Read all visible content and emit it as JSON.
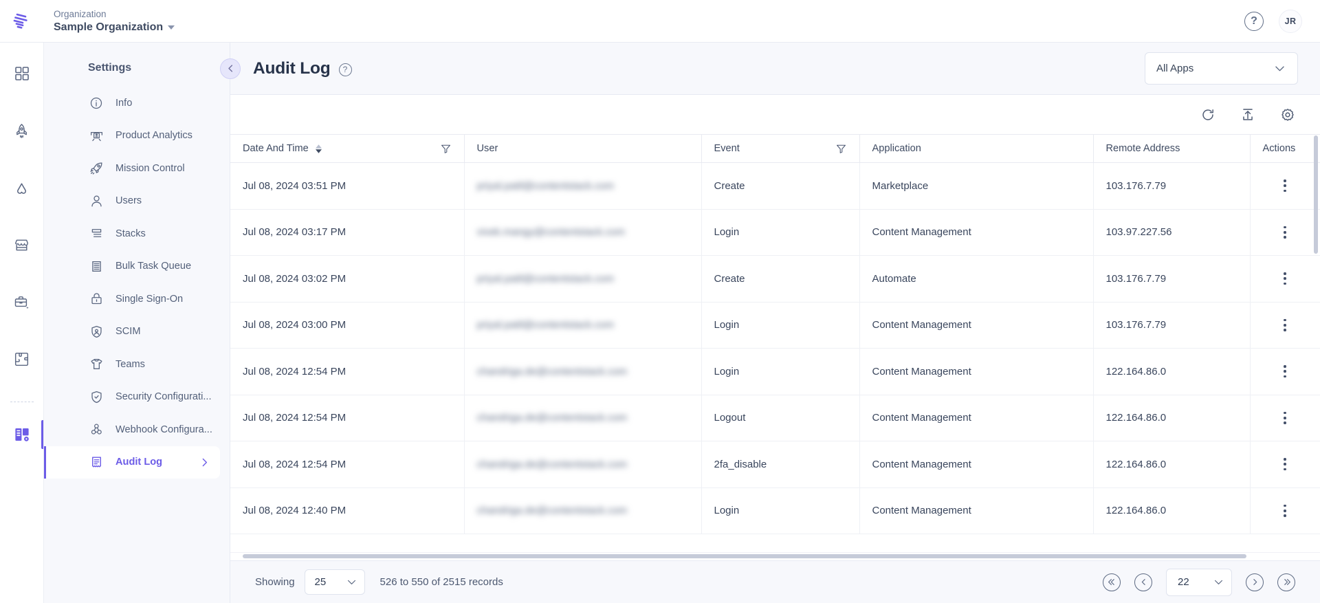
{
  "topbar": {
    "logo_icon": "contentstack-logo-icon",
    "org_label": "Organization",
    "org_name": "Sample Organization",
    "help_glyph": "?",
    "avatar_initials": "JR"
  },
  "rail": {
    "items": [
      {
        "icon": "dashboard-grid-icon",
        "name": "rail-item-dashboard",
        "active": false
      },
      {
        "icon": "rocket-icon",
        "name": "rail-item-launch",
        "active": false
      },
      {
        "icon": "automate-icon",
        "name": "rail-item-automate",
        "active": false
      },
      {
        "icon": "marketplace-icon",
        "name": "rail-item-marketplace",
        "active": false
      },
      {
        "icon": "briefcase-icon",
        "name": "rail-item-personalize",
        "active": false
      },
      {
        "icon": "puzzle-icon",
        "name": "rail-item-apps",
        "active": false
      },
      {
        "icon": "org-settings-icon",
        "name": "rail-item-org-settings",
        "active": true
      }
    ]
  },
  "sidebar": {
    "title": "Settings",
    "items": [
      {
        "label": "Info",
        "icon": "info-circle-icon",
        "active": false
      },
      {
        "label": "Product Analytics",
        "icon": "analytics-icon",
        "active": false
      },
      {
        "label": "Mission Control",
        "icon": "rocket-icon",
        "active": false
      },
      {
        "label": "Users",
        "icon": "user-icon",
        "active": false
      },
      {
        "label": "Stacks",
        "icon": "stacks-icon",
        "active": false
      },
      {
        "label": "Bulk Task Queue",
        "icon": "list-icon",
        "active": false
      },
      {
        "label": "Single Sign-On",
        "icon": "lock-icon",
        "active": false
      },
      {
        "label": "SCIM",
        "icon": "shield-user-icon",
        "active": false
      },
      {
        "label": "Teams",
        "icon": "tshirt-icon",
        "active": false
      },
      {
        "label": "Security Configurati...",
        "icon": "shield-check-icon",
        "active": false
      },
      {
        "label": "Webhook Configura...",
        "icon": "webhook-icon",
        "active": false
      },
      {
        "label": "Audit Log",
        "icon": "receipt-icon",
        "active": true
      }
    ]
  },
  "page": {
    "back_icon": "chevron-left-icon",
    "title": "Audit Log",
    "help_glyph": "?",
    "apps_filter_value": "All Apps",
    "apps_filter_icon": "chevron-down-icon"
  },
  "toolbar": {
    "refresh_icon": "refresh-icon",
    "export_icon": "export-upload-icon",
    "settings_icon": "gear-icon"
  },
  "table": {
    "columns": [
      {
        "label": "Date And Time",
        "sortable": true,
        "filterable": true
      },
      {
        "label": "User",
        "sortable": false,
        "filterable": false
      },
      {
        "label": "Event",
        "sortable": false,
        "filterable": true
      },
      {
        "label": "Application",
        "sortable": false,
        "filterable": false
      },
      {
        "label": "Remote Address",
        "sortable": false,
        "filterable": false
      },
      {
        "label": "Actions",
        "sortable": false,
        "filterable": false
      }
    ],
    "rows": [
      {
        "datetime": "Jul 08, 2024 03:51 PM",
        "user": "priyal.patil@contentstack.com",
        "event": "Create",
        "application": "Marketplace",
        "remote_address": "103.176.7.79"
      },
      {
        "datetime": "Jul 08, 2024 03:17 PM",
        "user": "vivek.mangy@contentstack.com",
        "event": "Login",
        "application": "Content Management",
        "remote_address": "103.97.227.56"
      },
      {
        "datetime": "Jul 08, 2024 03:02 PM",
        "user": "priyal.patil@contentstack.com",
        "event": "Create",
        "application": "Automate",
        "remote_address": "103.176.7.79"
      },
      {
        "datetime": "Jul 08, 2024 03:00 PM",
        "user": "priyal.patil@contentstack.com",
        "event": "Login",
        "application": "Content Management",
        "remote_address": "103.176.7.79"
      },
      {
        "datetime": "Jul 08, 2024 12:54 PM",
        "user": "chandriga.de@contentstack.com",
        "event": "Login",
        "application": "Content Management",
        "remote_address": "122.164.86.0"
      },
      {
        "datetime": "Jul 08, 2024 12:54 PM",
        "user": "chandriga.de@contentstack.com",
        "event": "Logout",
        "application": "Content Management",
        "remote_address": "122.164.86.0"
      },
      {
        "datetime": "Jul 08, 2024 12:54 PM",
        "user": "chandriga.de@contentstack.com",
        "event": "2fa_disable",
        "application": "Content Management",
        "remote_address": "122.164.86.0"
      },
      {
        "datetime": "Jul 08, 2024 12:40 PM",
        "user": "chandriga.de@contentstack.com",
        "event": "Login",
        "application": "Content Management",
        "remote_address": "122.164.86.0"
      }
    ],
    "row_action_icon": "kebab-menu-icon"
  },
  "footer": {
    "showing_label": "Showing",
    "page_size": "25",
    "records_label": "526 to 550 of 2515 records",
    "page_number": "22",
    "first_icon": "chevrons-left-icon",
    "prev_icon": "chevron-left-icon",
    "next_icon": "chevron-right-icon",
    "last_icon": "chevrons-right-icon"
  },
  "colors": {
    "accent": "#6c5ce7",
    "sidebar_bg": "#f7f8fc",
    "text": "#3f4b62",
    "border": "#e7eaf3"
  }
}
